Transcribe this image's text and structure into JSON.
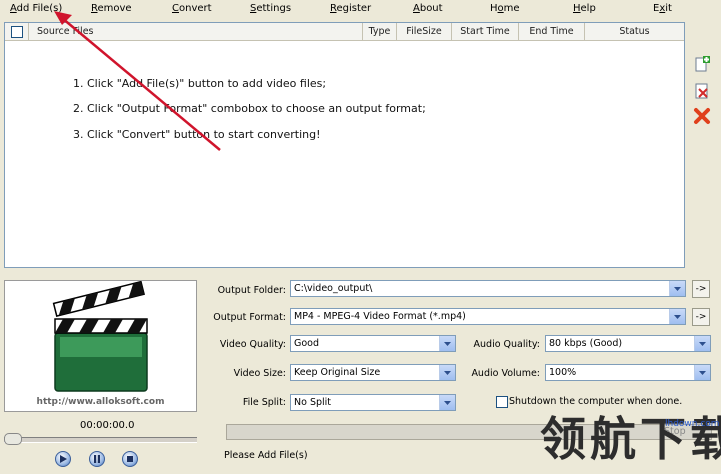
{
  "menu": [
    {
      "pre": "",
      "acc": "A",
      "post": "dd File(s)"
    },
    {
      "pre": "",
      "acc": "R",
      "post": "emove"
    },
    {
      "pre": "",
      "acc": "C",
      "post": "onvert"
    },
    {
      "pre": "",
      "acc": "S",
      "post": "ettings"
    },
    {
      "pre": "",
      "acc": "R",
      "post": "egister"
    },
    {
      "pre": "",
      "acc": "A",
      "post": "bout"
    },
    {
      "pre": "H",
      "acc": "o",
      "post": "me"
    },
    {
      "pre": "",
      "acc": "H",
      "post": "elp"
    },
    {
      "pre": "E",
      "acc": "x",
      "post": "it"
    }
  ],
  "columns": [
    "Source Files",
    "Type",
    "FileSize",
    "Start Time",
    "End Time",
    "Status"
  ],
  "instructions": [
    "1. Click \"Add File(s)\" button to add video files;",
    "2. Click \"Output Format\" combobox to choose an output format;",
    "3. Click \"Convert\" button to start converting!"
  ],
  "preview": {
    "url": "http://www.alloksoft.com",
    "time": "00:00:00.0"
  },
  "form": {
    "output_folder_label": "Output Folder:",
    "output_folder_value": "C:\\video_output\\",
    "output_format_label": "Output Format:",
    "output_format_value": "MP4 - MPEG-4 Video Format (*.mp4)",
    "video_quality_label": "Video Quality:",
    "video_quality_value": "Good",
    "audio_quality_label": "Audio Quality:",
    "audio_quality_value": "80  kbps (Good)",
    "video_size_label": "Video Size:",
    "video_size_value": "Keep Original Size",
    "audio_volume_label": "Audio Volume:",
    "audio_volume_value": "100%",
    "file_split_label": "File Split:",
    "file_split_value": "No Split",
    "shutdown_label": "Shutdown the computer when done.",
    "browse_label": "->"
  },
  "stop_label": "Stop",
  "status_text": "Please Add File(s)",
  "watermark": {
    "text": "领航下载",
    "url": "lhdown.com"
  },
  "colors": {
    "accent": "#316ac5",
    "arrow": "#d0142c"
  }
}
